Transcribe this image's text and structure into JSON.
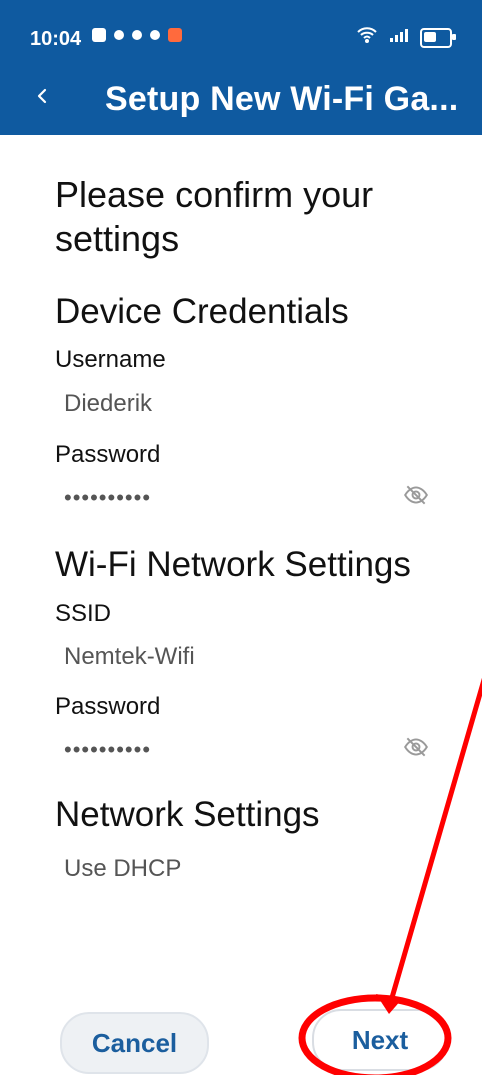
{
  "status": {
    "time": "10:04"
  },
  "appbar": {
    "title": "Setup New Wi-Fi Ga..."
  },
  "content": {
    "heading": "Please confirm your settings",
    "device": {
      "section_title": "Device Credentials",
      "username_label": "Username",
      "username_value": "Diederik",
      "password_label": "Password",
      "password_value": "••••••••••"
    },
    "wifi": {
      "section_title": "Wi-Fi Network Settings",
      "ssid_label": "SSID",
      "ssid_value": "Nemtek-Wifi",
      "password_label": "Password",
      "password_value": "••••••••••"
    },
    "network": {
      "section_title": "Network Settings",
      "value": "Use DHCP"
    }
  },
  "buttons": {
    "cancel": "Cancel",
    "next": "Next"
  },
  "colors": {
    "header": "#0f5aa0",
    "button_text": "#1b5e9e",
    "annotation": "#ff0000"
  },
  "icons": {
    "back": "arrow-left-icon",
    "toggle_password": "eye-off-icon"
  }
}
